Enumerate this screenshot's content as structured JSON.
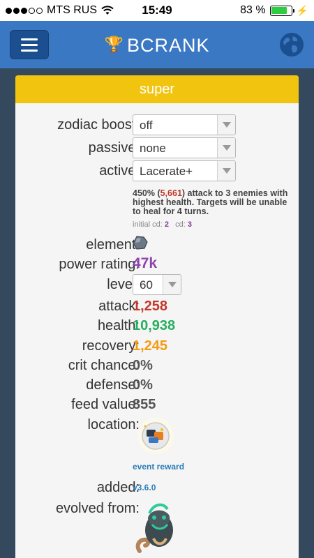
{
  "status_bar": {
    "carrier": "MTS RUS",
    "time": "15:49",
    "battery_text": "83 %",
    "battery_level": 0.83
  },
  "header": {
    "title": "BCRANK",
    "icons": [
      "menu-icon",
      "trophy-icon",
      "globe-icon"
    ]
  },
  "card": {
    "title": "super",
    "zodiac_boost": {
      "label": "zodiac boost:",
      "value": "off"
    },
    "passive": {
      "label": "passive:",
      "value": "none"
    },
    "active": {
      "label": "active:",
      "value": "Lacerate+"
    },
    "skill": {
      "prefix": "450% (",
      "damage": "5,661",
      "suffix": ") attack to 3 enemies with highest health. Targets will be unable to heal for 4 turns.",
      "initial_cd_label": "initial cd:",
      "initial_cd": "2",
      "cd_label": "cd:",
      "cd": "3"
    },
    "element": {
      "label": "element:",
      "icon": "rock-element-icon"
    },
    "power_rating": {
      "label": "power rating:",
      "value": "47k"
    },
    "level": {
      "label": "level:",
      "value": "60"
    },
    "attack": {
      "label": "attack:",
      "value": "1,258"
    },
    "health": {
      "label": "health:",
      "value": "10,938"
    },
    "recovery": {
      "label": "recovery:",
      "value": "1,245"
    },
    "crit_chance": {
      "label": "crit chance:",
      "value": "0%"
    },
    "defense": {
      "label": "defense:",
      "value": "0%"
    },
    "feed_value": {
      "label": "feed value:",
      "value": "855"
    },
    "location": {
      "label": "location:",
      "link": "event reward"
    },
    "added": {
      "label": "added:",
      "value": "v3.6.0"
    },
    "evolved_from": {
      "label": "evolved from:"
    }
  },
  "colors": {
    "header": "#3a78c4",
    "card_head": "#f1c40f",
    "power": "#8e44ad",
    "attack": "#c0392b",
    "health": "#27ae60",
    "recovery": "#f39c12"
  }
}
